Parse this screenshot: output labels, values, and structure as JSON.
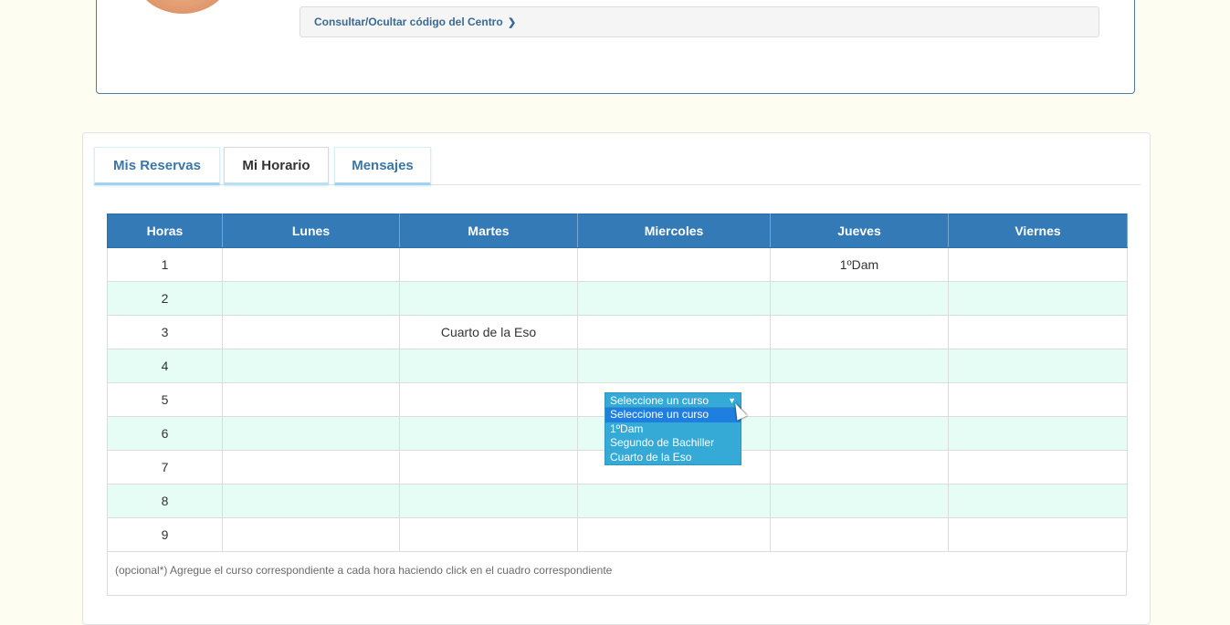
{
  "profile": {
    "code_link": "Consultar/Ocultar código del Centro",
    "chevron_icon": "chevron-right-icon"
  },
  "tabs": [
    {
      "label": "Mis Reservas",
      "active": false
    },
    {
      "label": "Mi Horario",
      "active": true
    },
    {
      "label": "Mensajes",
      "active": false
    }
  ],
  "schedule": {
    "headers": [
      "Horas",
      "Lunes",
      "Martes",
      "Miercoles",
      "Jueves",
      "Viernes"
    ],
    "rows": [
      [
        "1",
        "",
        "",
        "",
        "1ºDam",
        ""
      ],
      [
        "2",
        "",
        "",
        "",
        "",
        ""
      ],
      [
        "3",
        "",
        "Cuarto de la Eso",
        "",
        "",
        ""
      ],
      [
        "4",
        "",
        "",
        "",
        "",
        ""
      ],
      [
        "5",
        "",
        "",
        "",
        "",
        ""
      ],
      [
        "6",
        "",
        "",
        "",
        "",
        ""
      ],
      [
        "7",
        "",
        "",
        "",
        "",
        ""
      ],
      [
        "8",
        "",
        "",
        "",
        "",
        ""
      ],
      [
        "9",
        "",
        "",
        "",
        "",
        ""
      ]
    ]
  },
  "note": "(opcional*) Agregue el curso correspondiente a cada hora haciendo click en el cuadro correspondiente",
  "course_dropdown": {
    "selected": "Seleccione un curso",
    "options": [
      "Seleccione un curso",
      "1ºDam",
      "Segundo de Bachiller",
      "Cuarto de la Eso"
    ],
    "highlighted_index": 0
  },
  "colors": {
    "header": "#337ab7",
    "alt_row": "#e6fdf5",
    "dropdown": "#35aad6",
    "dropdown_highlight": "#1e7fe0",
    "link": "#3a6a94"
  }
}
